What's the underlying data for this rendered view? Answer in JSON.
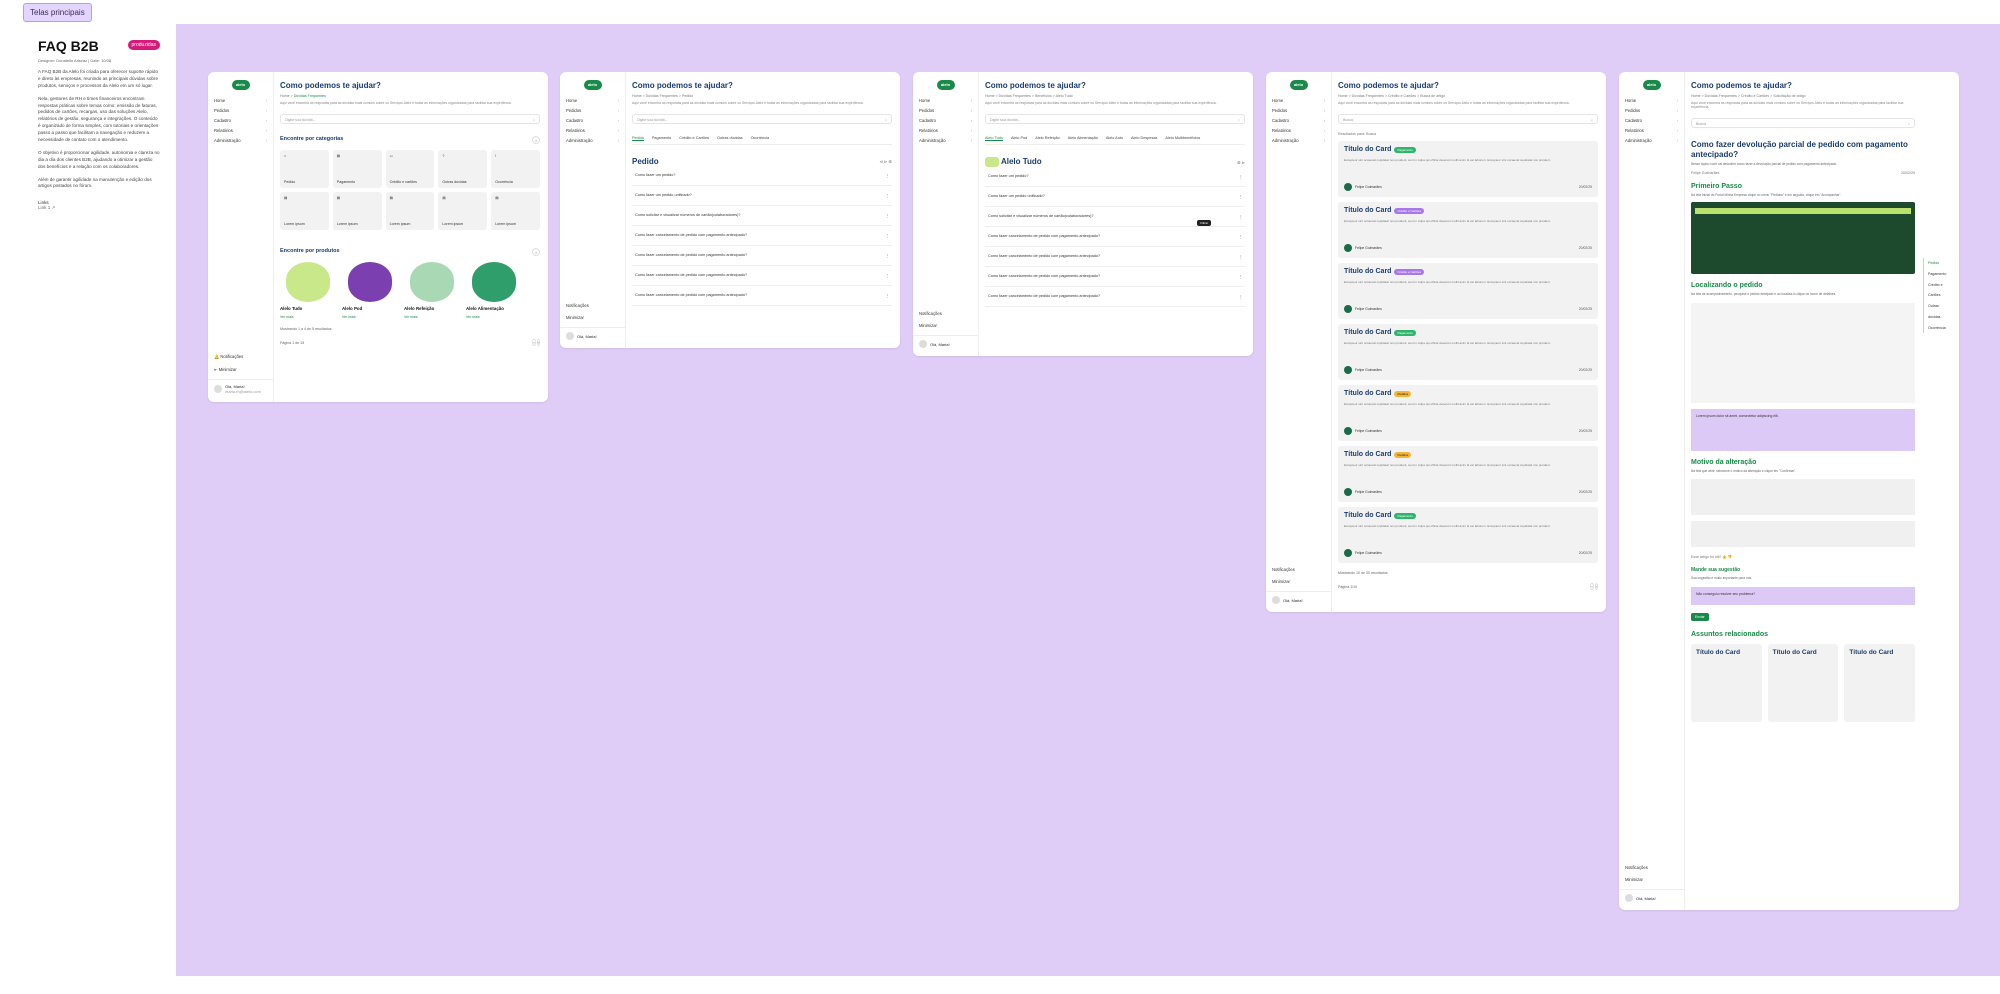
{
  "page_tag": "Telas principais",
  "intro": {
    "title": "FAQ B2B",
    "badge": "produzidas",
    "meta": "Designer: Donatello Ariscaz | Date: 10/08",
    "p1": "A FAQ B2B da Alelo foi criada para oferecer suporte rápido e direto às empresas, reunindo as principais dúvidas sobre produtos, serviços e processos da Alelo em um só lugar.",
    "p2": "Nela, gestores de RH e times financeiros encontram respostas práticas sobre temas como: emissão de faturas, pedidos de cartões, recargas, uso das soluções Alelo, relatórios de gestão, segurança e integrações. O conteúdo é organizado de forma simples, com tutoriais e orientações passo a passo que facilitam a navegação e reduzem a necessidade de contato com o atendimento.",
    "p3": "O objetivo é proporcionar agilidade, autonomia e clareza no dia a dia dos clientes B2B, ajudando a otimizar a gestão dos benefícios e a relação com os colaboradores.",
    "p4": "Além de garantir agilidade na manutenção e edição dos artigos postados no fórum.",
    "links_label": "Links",
    "link": "Link 1 ↗"
  },
  "common": {
    "logo": "alelo",
    "title": "Como podemos te ajudar?",
    "subtitle": "Aqui você encontra as respostas para as dúvidas mais comuns sobre os Serviços Alelo e todas as informações organizadas para facilitar sua experiência.",
    "search_placeholder": "Digite sua dúvida...",
    "nav": [
      "Home",
      "Pedidos",
      "Cadastro",
      "Relatórios",
      "Administração"
    ],
    "notifications": "Notificações",
    "minimize": "Minimizar",
    "user_name": "Olá, Maria!",
    "user_mail": "maria.rh@alelo.com"
  },
  "screen1": {
    "breadcrumb_home": "Home",
    "breadcrumb_current": "Dúvidas Frequentes",
    "categories_title": "Encontre por categorias",
    "categories": [
      "Pedido",
      "Pagamento",
      "Crédito e cartões",
      "Outras dúvidas",
      "Ocorrência",
      "Lorem ipsum",
      "Lorem ipsum",
      "Lorem ipsum",
      "Lorem ipsum",
      "Lorem ipsum"
    ],
    "products_title": "Encontre por produtos",
    "products": [
      "Alelo Tudo",
      "Alelo Pod",
      "Alelo Refeição",
      "Alelo Alimentação"
    ],
    "product_link": "Ver mais",
    "showing": "Mostrando 1 a 4 de 5 resultados",
    "page": "Página 1 de 15"
  },
  "screen2": {
    "breadcrumb": "Home > Dúvidas Frequentes > Pedido",
    "tabs": [
      "Pedido",
      "Pagamento",
      "Crédito e Cartões",
      "Outras dúvidas",
      "Ocorrência"
    ],
    "heading": "Pedido",
    "questions": [
      "Como fazer um pedido?",
      "Como fazer um pedido unificado?",
      "Como solicitar e visualizar números de cartão(colaboradores)?",
      "Como fazer cancelamento de pedido com pagamento antecipado?",
      "Como fazer cancelamento de pedido com pagamento antecipado?",
      "Como fazer cancelamento de pedido com pagamento antecipado?",
      "Como fazer cancelamento de pedido com pagamento antecipado?"
    ]
  },
  "screen3": {
    "breadcrumb": "Home > Dúvidas Frequentes > Benefícios > Alelo Tudo",
    "tabs": [
      "Alelo Tudo",
      "Alelo Pod",
      "Alelo Refeição",
      "Alelo Alimentação",
      "Alelo Auto",
      "Alelo Despesas",
      "Alelo Multibenefícios"
    ],
    "heading": "Alelo Tudo",
    "tooltip": "Filtrar",
    "questions": [
      "Como fazer um pedido?",
      "Como fazer um pedido unificado?",
      "Como solicitar e visualizar números de cartão(colaboradores)?",
      "Como fazer cancelamento de pedido com pagamento antecipado?",
      "Como fazer cancelamento de pedido com pagamento antecipado?",
      "Como fazer cancelamento de pedido com pagamento antecipado?",
      "Como fazer cancelamento de pedido com pagamento antecipado?"
    ]
  },
  "screen4": {
    "breadcrumb": "Home > Dúvidas Frequentes > Crédito e Cartões > Busca de artigo",
    "search_value": "Busca",
    "results_label": "Resultados para: Busca",
    "card_title": "Título do Card",
    "card_desc": "Excepteur sint occaecat cupidatat non proident, sunt in culpa qui officia deserunt mollit anim id est laborum. Excepteur sint occaecat cupidatat non proident.",
    "author": "Felipe Guimarães",
    "author_role": "Último atualizado",
    "date": "20/02/25",
    "tags": [
      "Pagamento",
      "Crédito e Cartões",
      "Crédito e Cartões",
      "Pagamento",
      "Pedidos",
      "Pedidos",
      "Pagamento"
    ],
    "showing": "Mostrando 10 de 30 resultados",
    "page": "Página 1/10"
  },
  "screen5": {
    "breadcrumb": "Home > Dúvidas Frequentes > Crédito e Cartões > Solicitação de artigo",
    "search_value": "Busca",
    "article_title": "Como fazer devolução parcial de pedido com pagamento antecipado?",
    "article_sub": "Nesse tópico você vai descobrir como fazer a devolução parcial de pedido com pagamento antecipado.",
    "author": "Felipe Guimarães",
    "date": "20/02/25",
    "toc": [
      "Pedido",
      "Pagamento",
      "Crédito e Cartões",
      "Outras dúvidas",
      "Ocorrência"
    ],
    "h_first": "Primeiro Passo",
    "p_first": "Na tela inicial do Portal Minha Empresa clique no menu \"Pedidos\" e em seguida, clique em \"Acompanhar\".",
    "h_locate": "Localizando o pedido",
    "p_locate": "Na tela de acompanhamento, pesquise o pedido desejado e ao localizá-lo clique no ícone de detalhes.",
    "purple_title": "Lorem ipsum dolor sit amet, consectetur adipiscing elit.",
    "h_reason": "Motivo da alteração",
    "p_reason": "Na tela que abrir, selecione o motivo da alteração e clique em \"Confirmar\".",
    "helpful": "Esse artigo foi útil?",
    "suggest_title": "Mande sua sugestão",
    "suggest_text": "Sua sugestão é muito importante para nós.",
    "alert": "Não conseguiu resolver seu problema?",
    "send": "Enviar",
    "related": "Assuntos relacionados",
    "related_card": "Título do Card"
  }
}
